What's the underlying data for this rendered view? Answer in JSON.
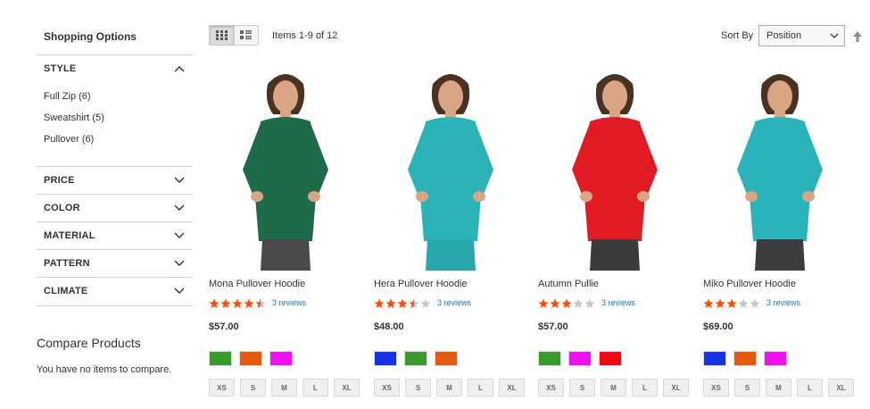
{
  "sidebar": {
    "title": "Shopping Options",
    "style_filter": {
      "title": "STYLE",
      "options": [
        {
          "label": "Full Zip",
          "count": "(6)"
        },
        {
          "label": "Sweatshirt",
          "count": "(5)"
        },
        {
          "label": "Pullover",
          "count": "(6)"
        }
      ]
    },
    "filters": [
      "PRICE",
      "COLOR",
      "MATERIAL",
      "PATTERN",
      "CLIMATE"
    ],
    "compare": {
      "title": "Compare Products",
      "empty_text": "You have no items to compare."
    }
  },
  "toolbar": {
    "amount": "Items 1-9 of 12",
    "sort_label": "Sort By",
    "sort_value": "Position",
    "view_modes": [
      "grid",
      "list"
    ]
  },
  "products": [
    {
      "name": "Mona Pullover Hoodie",
      "rating_stars": 4.5,
      "reviews": "3 reviews",
      "price": "$57.00",
      "shirt_color": "#1d6b48",
      "bottom_color": "#4a4a4a",
      "swatches": [
        "#3a9a2f",
        "#e35a10",
        "#ee11ee"
      ],
      "sizes": [
        "XS",
        "S",
        "M",
        "L",
        "XL"
      ]
    },
    {
      "name": "Hera Pullover Hoodie",
      "rating_stars": 3.5,
      "reviews": "3 reviews",
      "price": "$48.00",
      "shirt_color": "#2cb3b8",
      "bottom_color": "#2aa7aa",
      "swatches": [
        "#1633e6",
        "#3a9a2f",
        "#e35a10"
      ],
      "sizes": [
        "XS",
        "S",
        "M",
        "L",
        "XL"
      ]
    },
    {
      "name": "Autumn Pullie",
      "rating_stars": 3,
      "reviews": "3 reviews",
      "price": "$57.00",
      "shirt_color": "#e01b24",
      "bottom_color": "#3a3a3a",
      "swatches": [
        "#3a9a2f",
        "#ee11ee",
        "#ef0b16"
      ],
      "sizes": [
        "XS",
        "S",
        "M",
        "L",
        "XL"
      ]
    },
    {
      "name": "Miko Pullover Hoodie",
      "rating_stars": 3,
      "reviews": "3 reviews",
      "price": "$69.00",
      "shirt_color": "#2ab4b9",
      "bottom_color": "#3d3d3d",
      "swatches": [
        "#1633e6",
        "#e35a10",
        "#ee11ee"
      ],
      "sizes": [
        "XS",
        "S",
        "M",
        "L",
        "XL"
      ]
    }
  ],
  "colors": {
    "star_filled": "#ff4c00",
    "star_empty": "#c7c7c7",
    "link": "#1979c3"
  }
}
